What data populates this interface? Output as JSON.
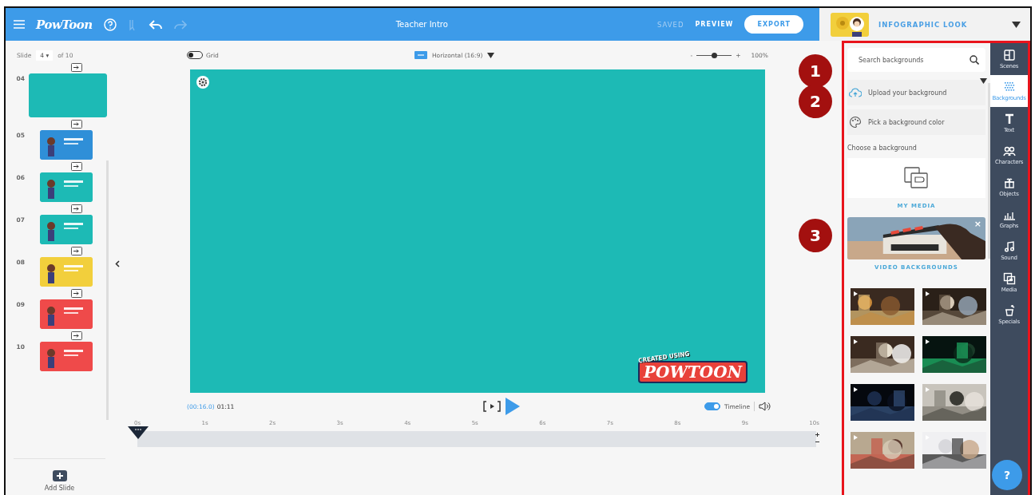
{
  "top_bar": {
    "logo": "PowToon",
    "title": "Teacher Intro",
    "saved": "SAVED",
    "preview": "PREVIEW",
    "export": "EXPORT",
    "style": "INFOGRAPHIC LOOK"
  },
  "slides_panel": {
    "slide_label": "Slide",
    "slide_number": "4",
    "slide_number_caret": "▾",
    "slide_total": "of 10",
    "add_slide": "Add Slide",
    "slides": [
      {
        "number": "04",
        "color": "#1dbab5",
        "selected": true
      },
      {
        "number": "05",
        "color": "#2f8fd8",
        "selected": false
      },
      {
        "number": "06",
        "color": "#1dbab5",
        "selected": false
      },
      {
        "number": "07",
        "color": "#1dbab5",
        "selected": false
      },
      {
        "number": "08",
        "color": "#f2cf3c",
        "selected": false
      },
      {
        "number": "09",
        "color": "#ef4a4a",
        "selected": false
      },
      {
        "number": "10",
        "color": "#ef4a4a",
        "selected": false
      }
    ]
  },
  "canvas_toolbar": {
    "grid": "Grid",
    "grid_on": false,
    "orientation": "Horizontal (16:9)",
    "zoom_out": "-",
    "zoom_in": "+",
    "zoom": {
      "level": 0.5
    },
    "zoom_reading": "100%"
  },
  "canvas": {
    "stamp_top": "CREATED USING",
    "stamp_logo": "POWTOON"
  },
  "playback": {
    "current": "(00:16.0)",
    "total": "01:11",
    "timeline": "Timeline",
    "timeline_on": true,
    "ticks": [
      "0s",
      "1s",
      "2s",
      "3s",
      "4s",
      "5s",
      "6s",
      "7s",
      "8s",
      "9s",
      "10s"
    ]
  },
  "backgrounds_panel": {
    "search_placeholder": "Search backgrounds",
    "upload": "Upload your background",
    "pick_color": "Pick a background color",
    "choose": "Choose a background",
    "my_media": "MY MEDIA",
    "video_close": "×",
    "video_backgrounds": "VIDEO BACKGROUNDS"
  },
  "tool_sidebar": [
    {
      "kind": "scenes",
      "label": "Scenes",
      "selected": false
    },
    {
      "kind": "backgrounds",
      "label": "Backgrounds",
      "selected": true
    },
    {
      "kind": "text",
      "label": "Text",
      "selected": false
    },
    {
      "kind": "characters",
      "label": "Characters",
      "selected": false
    },
    {
      "kind": "objects",
      "label": "Objects",
      "selected": false
    },
    {
      "kind": "graphs",
      "label": "Graphs",
      "selected": false
    },
    {
      "kind": "sound",
      "label": "Sound",
      "selected": false
    },
    {
      "kind": "media",
      "label": "Media",
      "selected": false
    },
    {
      "kind": "specials",
      "label": "Specials",
      "selected": false
    }
  ],
  "help": "?",
  "callouts": [
    "1",
    "2",
    "3"
  ]
}
